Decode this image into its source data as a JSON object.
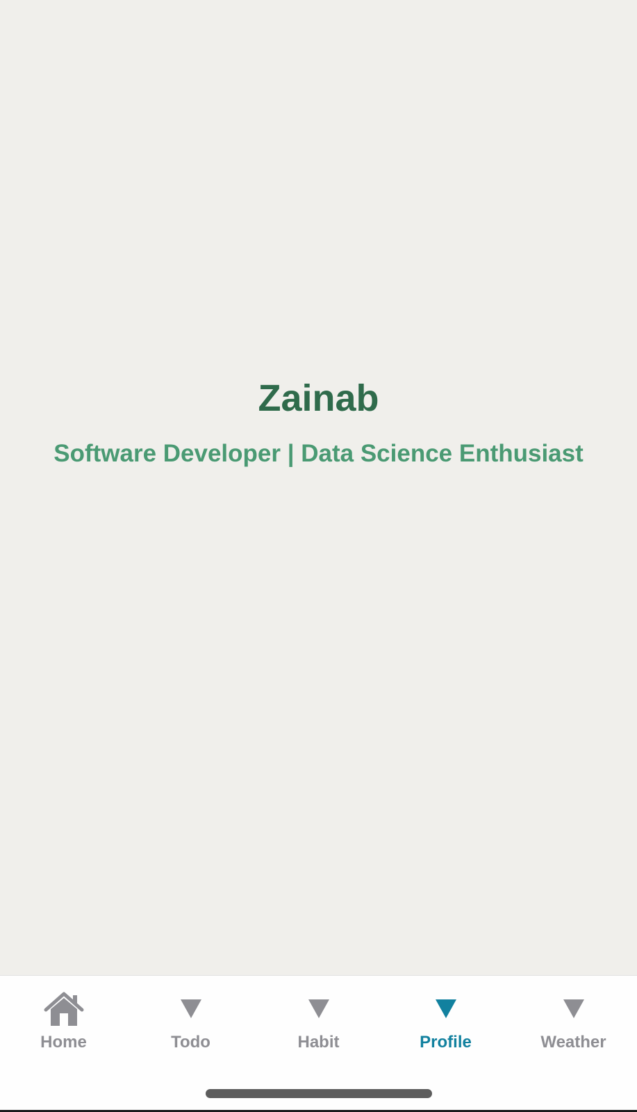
{
  "profile": {
    "name": "Zainab",
    "tagline": "Software Developer | Data Science Enthusiast"
  },
  "tabbar": {
    "active_tab": "Profile",
    "active_color": "#12819f",
    "inactive_color": "#8e8e93",
    "tabs": [
      {
        "label": "Home",
        "icon": "home-icon"
      },
      {
        "label": "Todo",
        "icon": "triangle-down-icon"
      },
      {
        "label": "Habit",
        "icon": "triangle-down-icon"
      },
      {
        "label": "Profile",
        "icon": "triangle-down-icon"
      },
      {
        "label": "Weather",
        "icon": "triangle-down-icon"
      }
    ]
  },
  "colors": {
    "background": "#f0efeb",
    "name_text": "#2f6b4b",
    "tagline_text": "#4a9a73"
  }
}
